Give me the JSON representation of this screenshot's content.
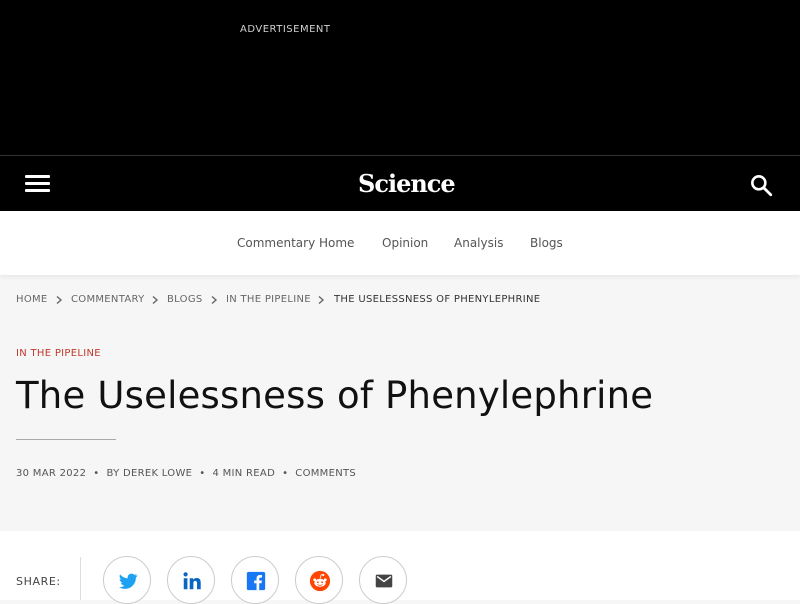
{
  "ad": {
    "label": "ADVERTISEMENT"
  },
  "header": {
    "logo": "Science"
  },
  "subnav": {
    "items": [
      {
        "label": "Commentary Home"
      },
      {
        "label": "Opinion"
      },
      {
        "label": "Analysis"
      },
      {
        "label": "Blogs"
      }
    ]
  },
  "breadcrumb": [
    "HOME",
    "COMMENTARY",
    "BLOGS",
    "IN THE PIPELINE",
    "THE USELESSNESS OF PHENYLEPHRINE"
  ],
  "article": {
    "kicker": "IN THE PIPELINE",
    "title": "The Uselessness of Phenylephrine",
    "date": "30 MAR 2022",
    "author": "BY DEREK LOWE",
    "read_time": "4 MIN READ",
    "comments": "COMMENTS"
  },
  "share": {
    "label": "SHARE:",
    "buttons": [
      "twitter-icon",
      "linkedin-icon",
      "facebook-icon",
      "reddit-icon",
      "email-icon"
    ]
  },
  "colors": {
    "kicker": "#c0392b",
    "twitter": "#1da1f2",
    "linkedin": "#0a66c2",
    "facebook": "#1877f2",
    "reddit": "#ff4500"
  }
}
